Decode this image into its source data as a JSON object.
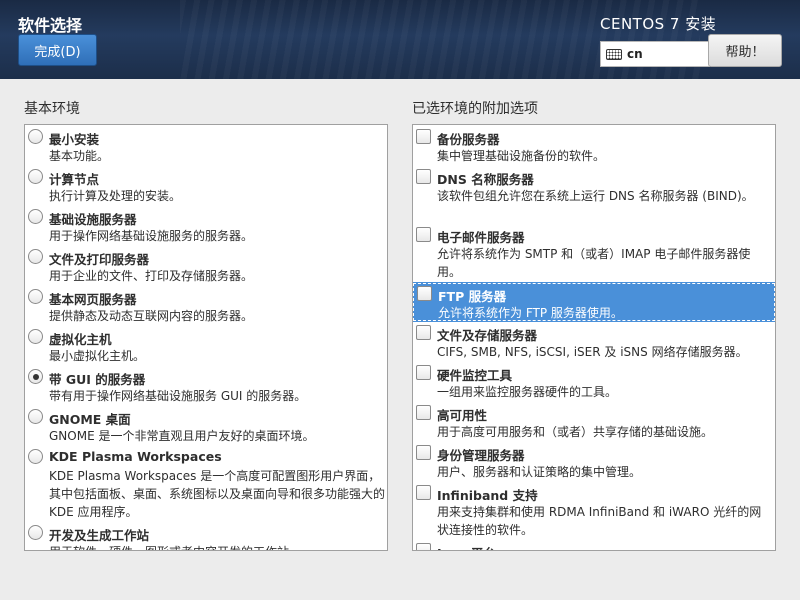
{
  "header": {
    "page_title": "软件选择",
    "done_label": "完成(D)",
    "product_title": "CENTOS 7 安装",
    "keyboard_icon": "keyboard-icon",
    "keyboard_layout": "cn",
    "help_label": "帮助！"
  },
  "base_environment": {
    "title": "基本环境",
    "items": [
      {
        "name": "最小安装",
        "desc": "基本功能。",
        "checked": false
      },
      {
        "name": "计算节点",
        "desc": "执行计算及处理的安装。",
        "checked": false
      },
      {
        "name": "基础设施服务器",
        "desc": "用于操作网络基础设施服务的服务器。",
        "checked": false
      },
      {
        "name": "文件及打印服务器",
        "desc": "用于企业的文件、打印及存储服务器。",
        "checked": false
      },
      {
        "name": "基本网页服务器",
        "desc": "提供静态及动态互联网内容的服务器。",
        "checked": false
      },
      {
        "name": "虚拟化主机",
        "desc": "最小虚拟化主机。",
        "checked": false
      },
      {
        "name": "带 GUI 的服务器",
        "desc": "带有用于操作网络基础设施服务 GUI 的服务器。",
        "checked": true
      },
      {
        "name": "GNOME 桌面",
        "desc": "GNOME 是一个非常直观且用户友好的桌面环境。",
        "checked": false
      },
      {
        "name": "KDE Plasma Workspaces",
        "desc": "KDE Plasma Workspaces 是一个高度可配置图形用户界面，其中包括面板、桌面、系统图标以及桌面向导和很多功能强大的 KDE 应用程序。",
        "checked": false
      },
      {
        "name": "开发及生成工作站",
        "desc": "用于软件、硬件、图形或者内容开发的工作站。",
        "checked": false
      }
    ]
  },
  "addons": {
    "title": "已选环境的附加选项",
    "items": [
      {
        "name": "备份服务器",
        "desc": "集中管理基础设施备份的软件。",
        "checked": false,
        "selected": false
      },
      {
        "name": "DNS 名称服务器",
        "desc": "该软件包组允许您在系统上运行 DNS 名称服务器 (BIND)。",
        "checked": false,
        "selected": false
      },
      {
        "name": "电子邮件服务器",
        "desc": "允许将系统作为 SMTP 和（或者）IMAP 电子邮件服务器使用。",
        "checked": false,
        "selected": false
      },
      {
        "name": "FTP 服务器",
        "desc": "允许将系统作为 FTP 服务器使用。",
        "checked": false,
        "selected": true
      },
      {
        "name": "文件及存储服务器",
        "desc": "CIFS, SMB, NFS, iSCSI, iSER 及 iSNS 网络存储服务器。",
        "checked": false,
        "selected": false
      },
      {
        "name": "硬件监控工具",
        "desc": "一组用来监控服务器硬件的工具。",
        "checked": false,
        "selected": false
      },
      {
        "name": "高可用性",
        "desc": "用于高度可用服务和（或者）共享存储的基础设施。",
        "checked": false,
        "selected": false
      },
      {
        "name": "身份管理服务器",
        "desc": "用户、服务器和认证策略的集中管理。",
        "checked": false,
        "selected": false
      },
      {
        "name": "Infiniband 支持",
        "desc": "用来支持集群和使用 RDMA InfiniBand 和 iWARO 光纤的网状连接性的软件。",
        "checked": false,
        "selected": false
      },
      {
        "name": "Java 平台",
        "desc": "",
        "checked": false,
        "selected": false
      }
    ]
  }
}
